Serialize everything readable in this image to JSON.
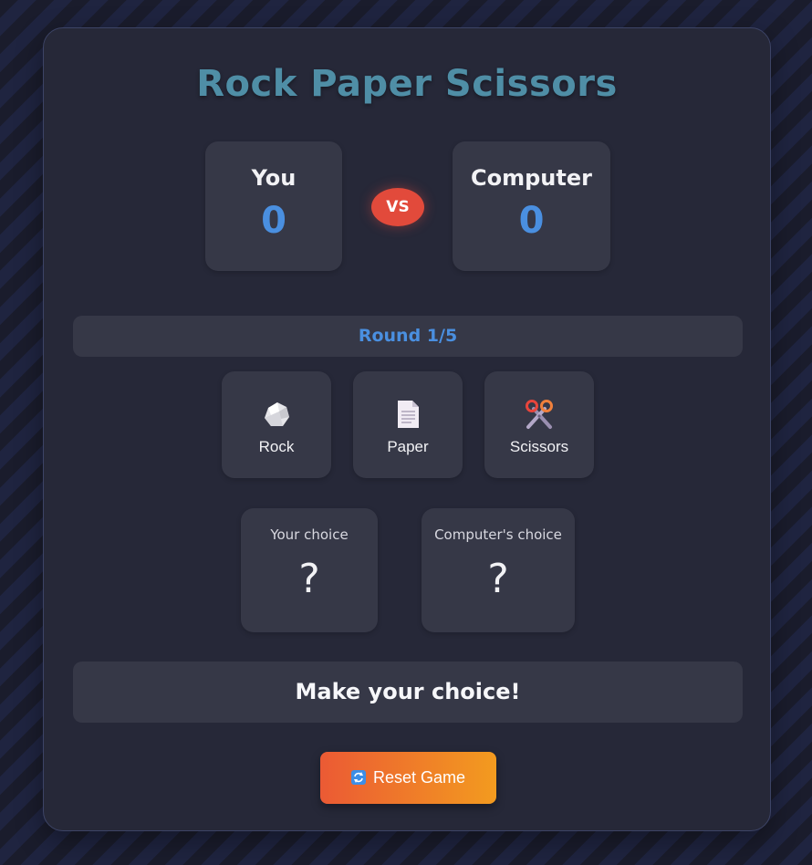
{
  "title": "Rock Paper Scissors",
  "scoreboard": {
    "player_label": "You",
    "player_score": "0",
    "vs_label": "VS",
    "computer_label": "Computer",
    "computer_score": "0"
  },
  "round": {
    "text": "Round 1/5"
  },
  "choices": [
    {
      "label": "Rock",
      "icon": "rock-icon"
    },
    {
      "label": "Paper",
      "icon": "paper-icon"
    },
    {
      "label": "Scissors",
      "icon": "scissors-icon"
    }
  ],
  "picks": {
    "player_label": "Your choice",
    "player_value": "?",
    "computer_label": "Computer's choice",
    "computer_value": "?"
  },
  "message": "Make your choice!",
  "reset_button": {
    "label": "Reset Game",
    "icon": "refresh-icon"
  },
  "colors": {
    "accent_blue": "#4a8fe0",
    "vs_red": "#e24a3b",
    "reset_start": "#eb5a34",
    "reset_end": "#f39b1f",
    "title": "#4f8ea6"
  }
}
